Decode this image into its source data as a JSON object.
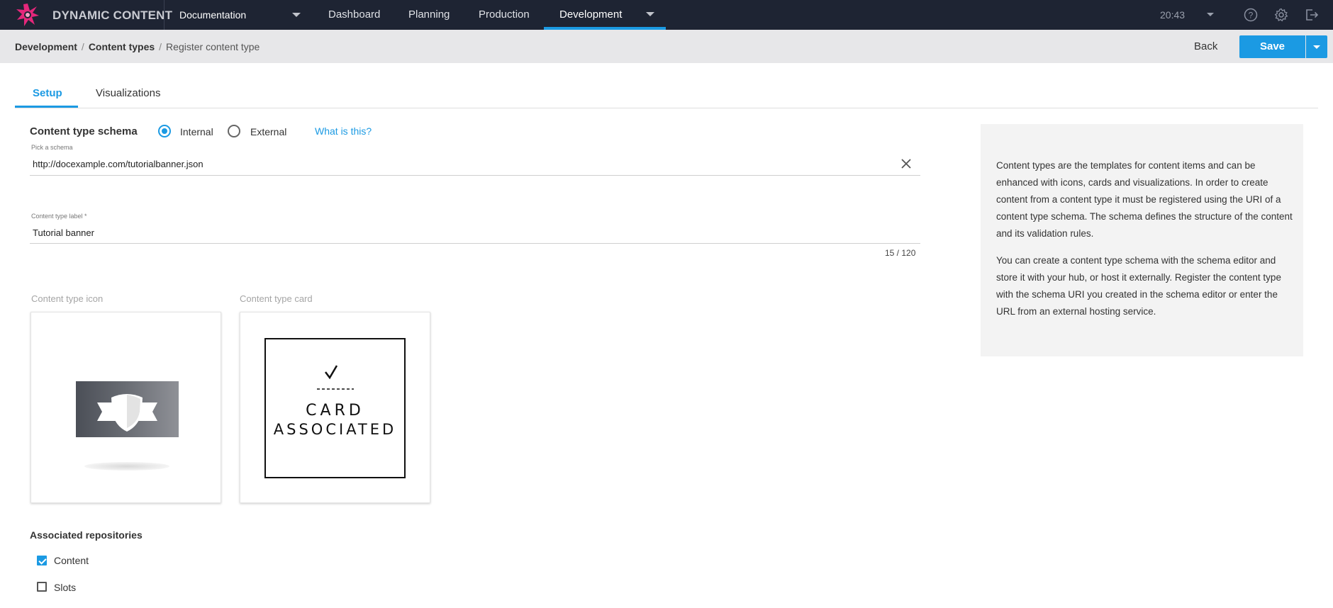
{
  "app": {
    "brand": "DYNAMIC CONTENT",
    "hub": "Documentation",
    "clock": "20:43"
  },
  "nav": {
    "dashboard": "Dashboard",
    "planning": "Planning",
    "production": "Production",
    "development": "Development"
  },
  "icons": {
    "logo": "starburst-logo-icon",
    "help": "help-icon",
    "settings": "gear-icon",
    "signout": "sign-out-icon",
    "clear": "close-icon"
  },
  "breadcrumb": {
    "level1": "Development",
    "level2": "Content types",
    "current": "Register content type"
  },
  "actions": {
    "back": "Back",
    "save": "Save"
  },
  "tabs": {
    "setup": "Setup",
    "visualizations": "Visualizations"
  },
  "schema": {
    "heading": "Content type schema",
    "radio_internal": "Internal",
    "radio_external": "External",
    "selected": "Internal",
    "help_link": "What is this?",
    "picker_caption": "Pick a schema",
    "picker_value": "http://docexample.com/tutorialbanner.json"
  },
  "label_field": {
    "caption": "Content type label *",
    "value": "Tutorial banner",
    "counter": "15 / 120"
  },
  "media": {
    "icon_label": "Content type icon",
    "card_label": "Content type card",
    "card_placeholder_line1": "CARD",
    "card_placeholder_line2": "ASSOCIATED"
  },
  "repositories": {
    "heading": "Associated repositories",
    "items": [
      {
        "label": "Content",
        "checked": true
      },
      {
        "label": "Slots",
        "checked": false
      }
    ]
  },
  "help": {
    "p1": "Content types are the templates for content items and can be enhanced with icons, cards and visualizations. In order to create content from a content type it must be registered using the URI of a content type schema. The schema defines the structure of the content and its validation rules.",
    "p2": "You can create a content type schema with the schema editor and store it with your hub, or host it externally. Register the content type with the schema URI you created in the schema editor or enter the URL from an external hosting service."
  },
  "colors": {
    "accent": "#1b9ae3",
    "topbar": "#1e2433",
    "logo_pink": "#e5277b"
  }
}
